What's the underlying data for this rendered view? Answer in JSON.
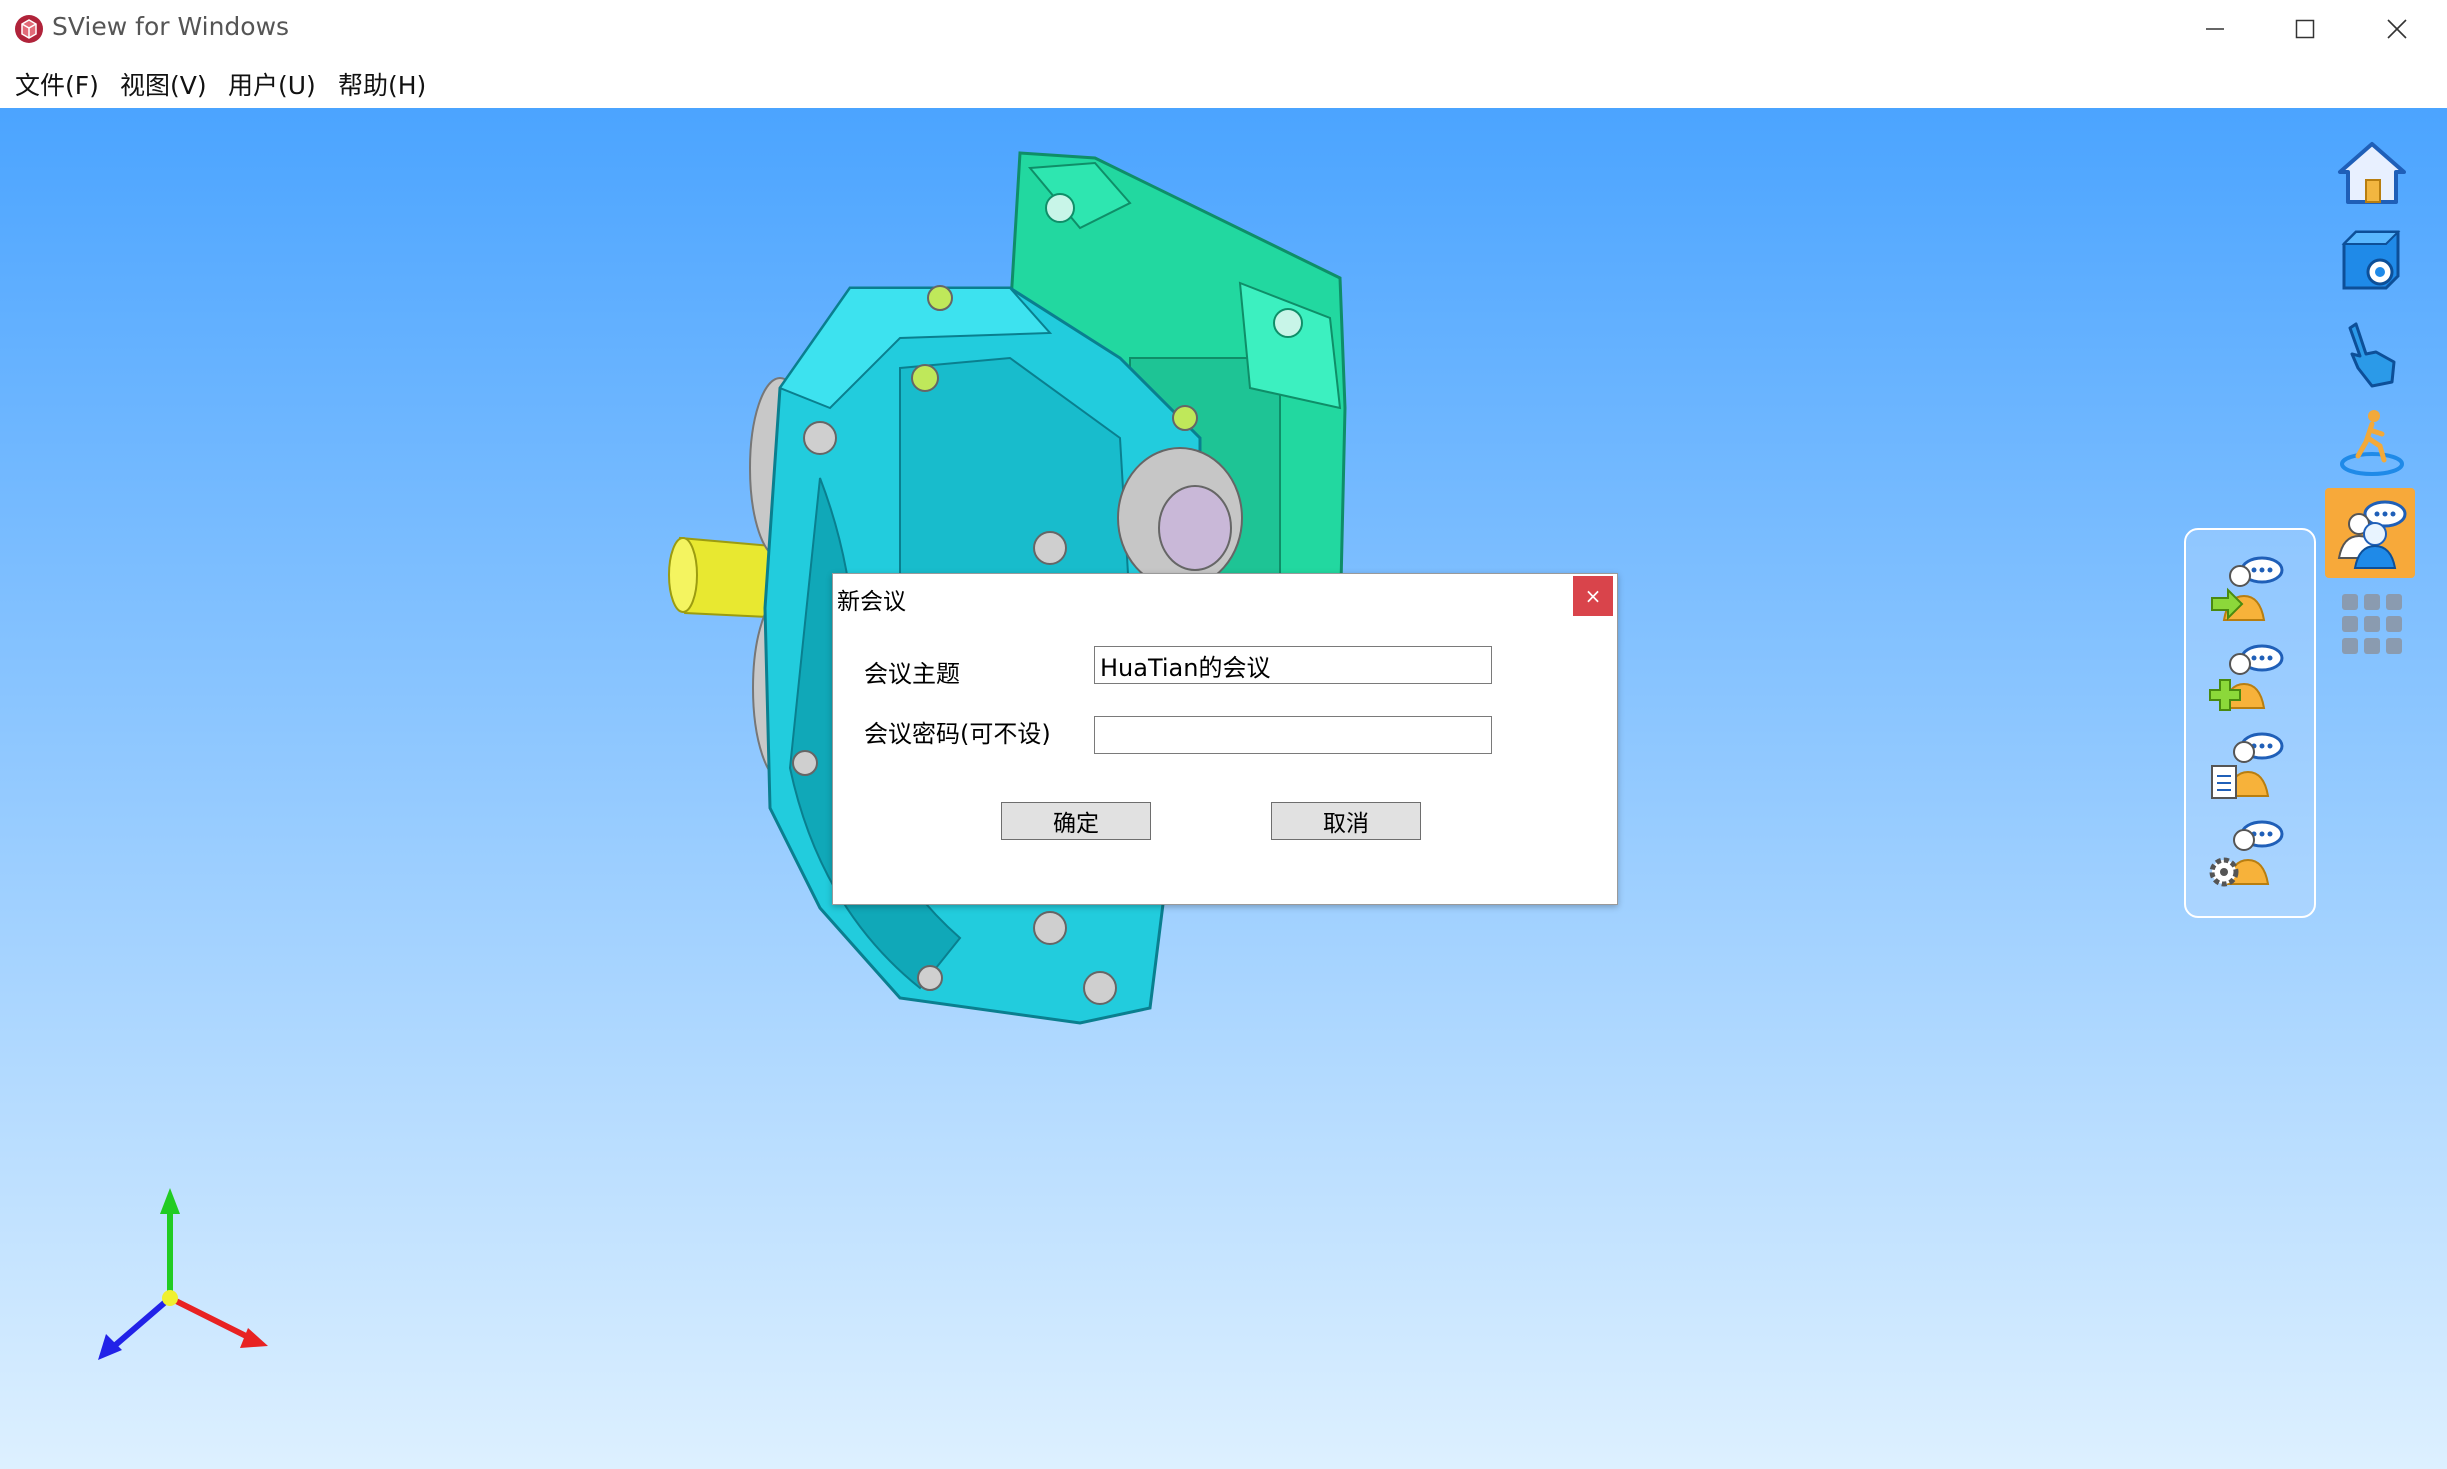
{
  "window": {
    "title": "SView for Windows",
    "minimize_glyph": "—",
    "maximize_glyph": "☐",
    "close_glyph": "✕"
  },
  "menu": {
    "items": [
      {
        "label": "文件(F)"
      },
      {
        "label": "视图(V)"
      },
      {
        "label": "用户(U)"
      },
      {
        "label": "帮助(H)"
      }
    ]
  },
  "toolbar": {
    "icons": [
      "home-icon",
      "model-settings-icon",
      "hand-pointer-icon",
      "walk-mode-icon",
      "meeting-icon",
      "app-grid-icon"
    ],
    "active": "meeting-icon",
    "active_color": "#f7a93a"
  },
  "collab_panel": {
    "icons": [
      "join-meeting-icon",
      "create-meeting-icon",
      "meeting-notes-icon",
      "meeting-settings-icon"
    ]
  },
  "dialog": {
    "title": "新会议",
    "close_glyph": "×",
    "topic_label": "会议主题",
    "topic_value": "HuaTian的会议",
    "password_label": "会议密码(可不设)",
    "password_value": "",
    "ok_label": "确定",
    "cancel_label": "取消"
  },
  "colors": {
    "viewport_top": "#4ba4ff",
    "viewport_bottom": "#ddf0ff",
    "model_cyan": "#22ccdd",
    "model_green": "#22d8a0",
    "shaft_yellow": "#e8e830",
    "close_red": "#d9444b"
  }
}
